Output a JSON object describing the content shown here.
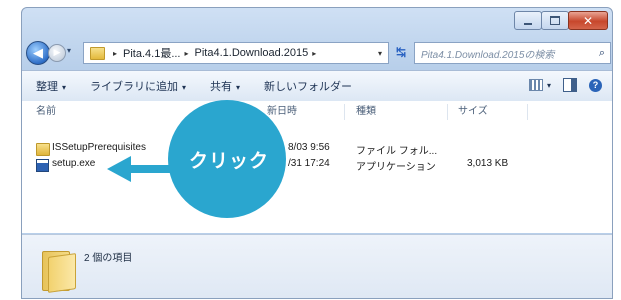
{
  "window": {
    "controls": {
      "minimize_icon": "minimize-icon",
      "maximize_icon": "maximize-icon",
      "close_icon": "close-icon",
      "close_color": "#c7472c"
    }
  },
  "address_bar": {
    "crumbs": [
      "Pita.4.1最...",
      "Pita4.1.Download.2015"
    ],
    "separator": "▸",
    "dropdown": "▾"
  },
  "search": {
    "placeholder": "Pita4.1.Download.2015の検索",
    "icon": "search-icon"
  },
  "commands": {
    "organize": "整理",
    "add_to_library": "ライブラリに追加",
    "share": "共有",
    "new_folder": "新しいフォルダー",
    "arrow": "▾"
  },
  "columns": {
    "name": "名前",
    "date": "新日時",
    "type": "種類",
    "size": "サイズ"
  },
  "files": [
    {
      "name": "ISSetupPrerequisites",
      "date": "8/03 9:56",
      "type": "ファイル フォル...",
      "size": "",
      "icon": "folder-icon"
    },
    {
      "name": "setup.exe",
      "date": "/31 17:24",
      "type": "アプリケーション",
      "size": "3,013 KB",
      "icon": "exe-icon"
    }
  ],
  "details": {
    "item_count": "2 個の項目"
  },
  "annotation": {
    "label": "クリック",
    "color": "#2aa6cf"
  }
}
